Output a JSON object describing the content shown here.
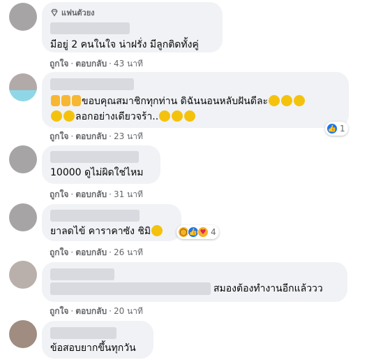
{
  "comments": [
    {
      "badge": "แฟนตัวยง",
      "text": "มีอยู่ 2 คนในใจ น่าฝรั่ง มีลูกติดทั้งคู่",
      "like": "ถูกใจ",
      "reply": "ตอบกลับ",
      "time": "43 นาที"
    },
    {
      "text_line1": "ขอบคุณสมาชิกทุกท่าน ดิฉันนอนหลับฝันดีละ",
      "text_line2": "ลอกอย่างเดียวจร้า..",
      "like": "ถูกใจ",
      "reply": "ตอบกลับ",
      "time": "23 นาที",
      "reaction_count": "1"
    },
    {
      "text": "10000 ดูไม่ผิดใช่ไหม",
      "like": "ถูกใจ",
      "reply": "ตอบกลับ",
      "time": "31 นาที"
    },
    {
      "text": "ยาลดไข้ คาราคาซัง ชิมิ",
      "like": "ถูกใจ",
      "reply": "ตอบกลับ",
      "time": "26 นาที",
      "reaction_count": "4"
    },
    {
      "text": "สมองต้องทำงานอีกแล้ววว",
      "like": "ถูกใจ",
      "reply": "ตอบกลับ",
      "time": "20 นาที"
    },
    {
      "text": "ข้อสอบยากขึ้นทุกวัน"
    }
  ],
  "icons": {
    "fan": "diamond-icon",
    "reaction_like": "like-icon",
    "reaction_wow": "wow-icon",
    "reaction_care": "care-icon"
  },
  "colors": {
    "bubble": "#f0f2f5",
    "meta": "#65676b",
    "like_blue": "#1877f2"
  }
}
